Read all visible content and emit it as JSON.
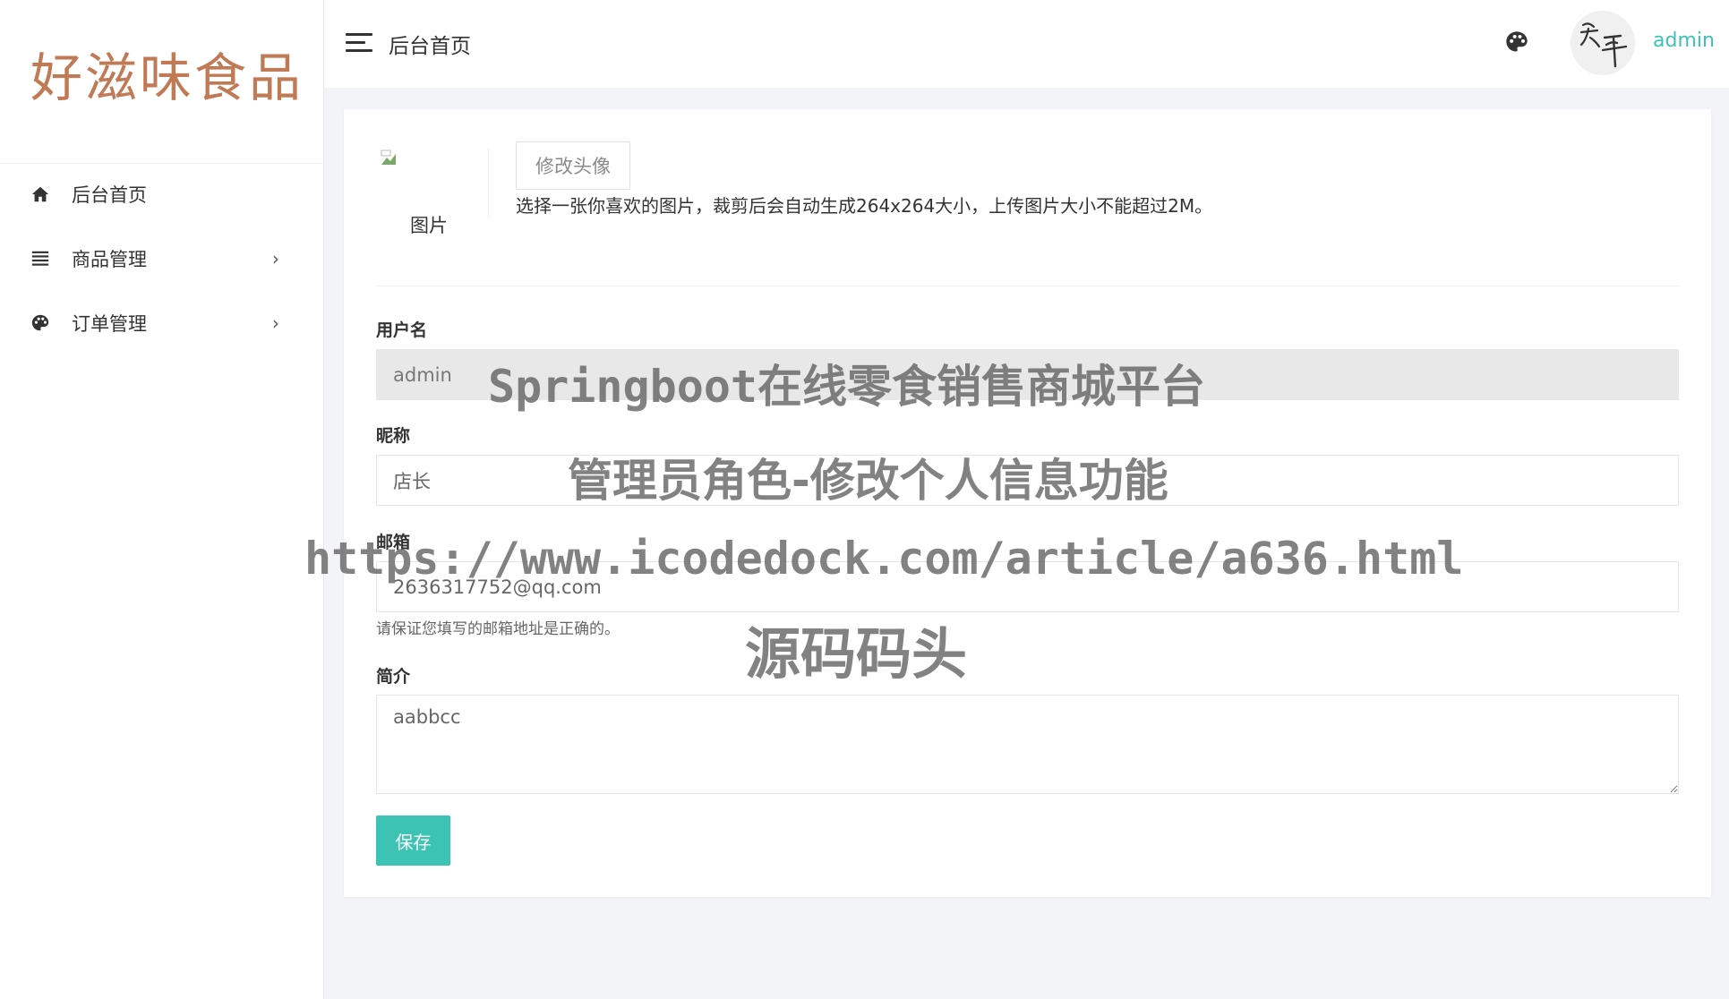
{
  "brand": {
    "logo_text": "好滋味食品",
    "logo_color": "#c07a55",
    "accent_color": "#3cc3b3"
  },
  "sidebar": {
    "items": [
      {
        "label": "后台首页",
        "icon": "home-icon",
        "has_children": false
      },
      {
        "label": "商品管理",
        "icon": "list-icon",
        "has_children": true
      },
      {
        "label": "订单管理",
        "icon": "palette-icon",
        "has_children": true
      }
    ]
  },
  "header": {
    "title": "后台首页",
    "username": "admin",
    "avatar_icon": "user-avatar"
  },
  "profile": {
    "avatar_alt": "图片",
    "change_avatar_label": "修改头像",
    "avatar_hint": "选择一张你喜欢的图片，裁剪后会自动生成264x264大小，上传图片大小不能超过2M。",
    "fields": {
      "username": {
        "label": "用户名",
        "value": "admin"
      },
      "nickname": {
        "label": "昵称",
        "value": "店长"
      },
      "email": {
        "label": "邮箱",
        "value": "2636317752@qq.com",
        "help": "请保证您填写的邮箱地址是正确的。"
      },
      "bio": {
        "label": "简介",
        "value": "aabbcc"
      }
    },
    "save_label": "保存"
  },
  "watermark": {
    "line1": "Springboot在线零食销售商城平台",
    "line2": "管理员角色-修改个人信息功能",
    "line3": "https://www.icodedock.com/article/a636.html",
    "line4": "源码码头"
  }
}
